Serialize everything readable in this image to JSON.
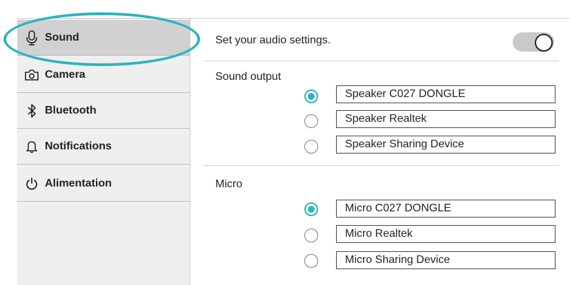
{
  "sidebar": {
    "items": [
      {
        "label": "Sound",
        "icon": "microphone-icon",
        "active": true
      },
      {
        "label": "Camera",
        "icon": "camera-icon",
        "active": false
      },
      {
        "label": "Bluetooth",
        "icon": "bluetooth-icon",
        "active": false
      },
      {
        "label": "Notifications",
        "icon": "bell-icon",
        "active": false
      },
      {
        "label": "Alimentation",
        "icon": "power-icon",
        "active": false
      }
    ]
  },
  "main": {
    "header": "Set your audio settings.",
    "toggle_on": true,
    "sound_output": {
      "title": "Sound output",
      "devices": [
        {
          "label": "Speaker C027 DONGLE",
          "selected": true
        },
        {
          "label": "Speaker Realtek",
          "selected": false
        },
        {
          "label": "Speaker Sharing Device",
          "selected": false
        }
      ]
    },
    "micro": {
      "title": "Micro",
      "devices": [
        {
          "label": "Micro C027 DONGLE",
          "selected": true
        },
        {
          "label": "Micro Realtek",
          "selected": false
        },
        {
          "label": "Micro Sharing Device",
          "selected": false
        }
      ]
    }
  },
  "colors": {
    "accent": "#2ab5bd",
    "sidebar_bg": "#efefef",
    "sidebar_active": "#d1d1d1"
  }
}
